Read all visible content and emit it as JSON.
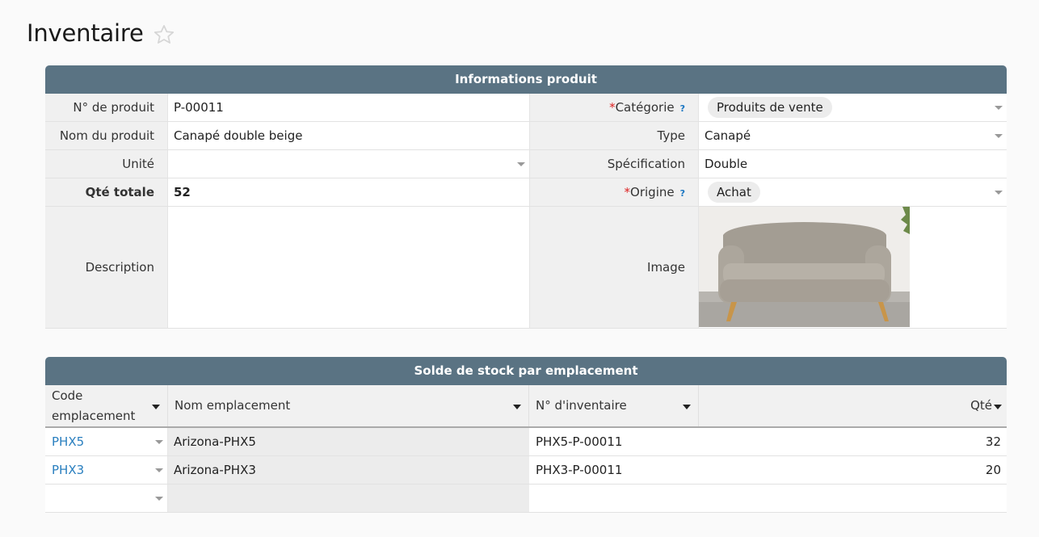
{
  "page": {
    "title": "Inventaire"
  },
  "info": {
    "header": "Informations produit",
    "product_no_label": "N° de produit",
    "product_no": "P-00011",
    "category_label": "Catégorie",
    "category": "Produits de vente",
    "product_name_label": "Nom du produit",
    "product_name": "Canapé double beige",
    "type_label": "Type",
    "type": "Canapé",
    "unit_label": "Unité",
    "unit": "",
    "spec_label": "Spécification",
    "spec": "Double",
    "total_qty_label": "Qté totale",
    "total_qty": "52",
    "origin_label": "Origine",
    "origin": "Achat",
    "description_label": "Description",
    "description": "",
    "image_label": "Image",
    "required_mark": "*",
    "help_mark": "?"
  },
  "stock": {
    "header": "Solde de stock par emplacement",
    "columns": [
      "Code emplacement",
      "Nom emplacement",
      "N° d'inventaire",
      "Qté"
    ],
    "rows": [
      {
        "code": "PHX5",
        "name": "Arizona-PHX5",
        "inv": "PHX5-P-00011",
        "qty": "32"
      },
      {
        "code": "PHX3",
        "name": "Arizona-PHX3",
        "inv": "PHX3-P-00011",
        "qty": "20"
      },
      {
        "code": "",
        "name": "",
        "inv": "",
        "qty": ""
      }
    ]
  },
  "colors": {
    "header_bg": "#5a7383",
    "link": "#2a7fbf",
    "required": "#d22222",
    "help": "#1a76c2"
  }
}
